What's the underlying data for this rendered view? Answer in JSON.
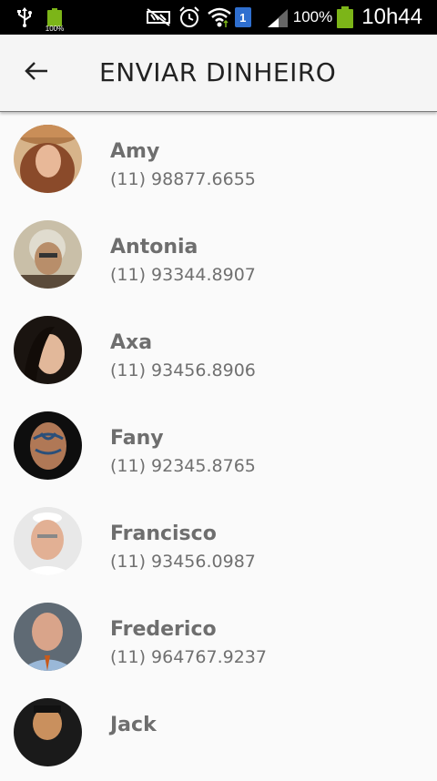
{
  "status_bar": {
    "left_battery_percent": "100%",
    "sim_slot": "1",
    "battery_percent": "100%",
    "time": "10h44",
    "icons": [
      "usb-icon",
      "battery-icon",
      "nfc-off-icon",
      "alarm-icon",
      "wifi-icon",
      "sim-icon",
      "signal-icon"
    ]
  },
  "header": {
    "title": "ENVIAR DINHEIRO",
    "back_icon": "arrow-back-icon"
  },
  "contacts": [
    {
      "name": "Amy",
      "phone": "(11) 98877.6655"
    },
    {
      "name": "Antonia",
      "phone": "(11) 93344.8907"
    },
    {
      "name": "Axa",
      "phone": "(11) 93456.8906"
    },
    {
      "name": "Fany",
      "phone": "(11) 92345.8765"
    },
    {
      "name": "Francisco",
      "phone": "(11) 93456.0987"
    },
    {
      "name": "Frederico",
      "phone": "(11) 964767.9237"
    },
    {
      "name": "Jack",
      "phone": ""
    }
  ],
  "colors": {
    "status_bar_bg": "#000000",
    "battery_green": "#7cb518",
    "app_bar_bg": "#f5f5f5",
    "list_bg": "#fafafa",
    "name_text": "#6e6e6e",
    "phone_text": "#707070"
  }
}
